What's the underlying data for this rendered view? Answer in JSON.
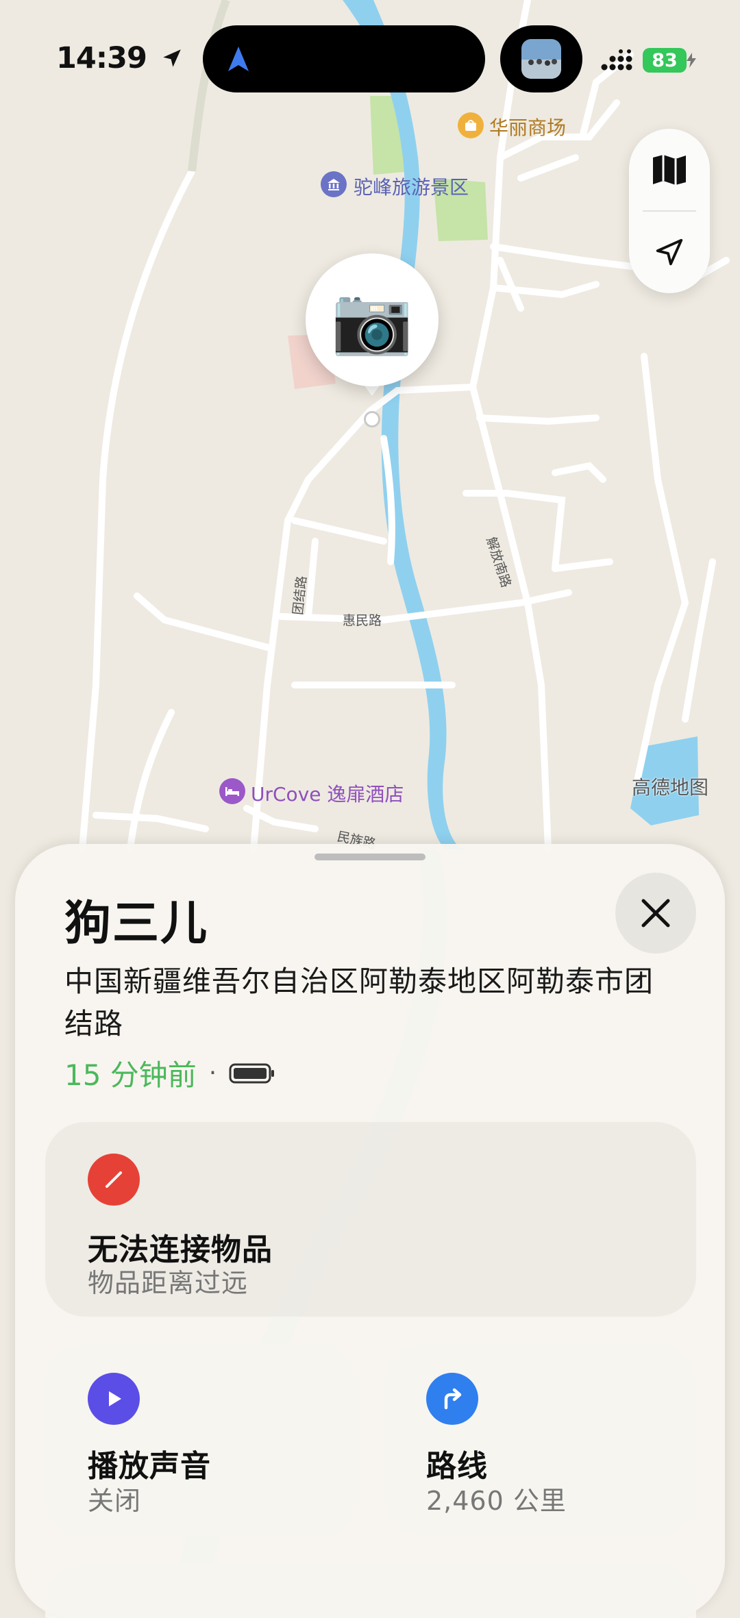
{
  "status_bar": {
    "time": "14:39",
    "battery": "83",
    "icons": [
      "location-arrow-icon",
      "navigation-icon",
      "signal-icon",
      "charging-bolt-icon"
    ]
  },
  "map": {
    "labels": {
      "mall": "华丽商场",
      "scenic": "驼峰旅游景区",
      "road_jiefang": "解放南路",
      "road_huimin": "惠民路",
      "road_tuanjie": "团结路",
      "road_minzu": "民族路",
      "hotel": "UrCove 逸扉酒店",
      "attribution": "高德地图"
    },
    "colors": {
      "land": "#eeeae1",
      "river": "#8fd0ef",
      "park": "#c6e3a8",
      "road": "#ffffff"
    }
  },
  "map_controls": {
    "icons": [
      "map-icon",
      "location-arrow-icon"
    ]
  },
  "pin": {
    "emoji": "📷"
  },
  "sheet": {
    "title": "狗三儿",
    "address": "中国新疆维吾尔自治区阿勒泰地区阿勒泰市团结路",
    "last_seen": "15 分钟前",
    "separator": "·",
    "cards": {
      "connection": {
        "title": "无法连接物品",
        "subtitle": "物品距离过远",
        "color": "#e64136",
        "icon": "slash-icon"
      },
      "sound": {
        "title": "播放声音",
        "subtitle": "关闭",
        "color": "#5b4ee6",
        "icon": "play-icon"
      },
      "directions": {
        "title": "路线",
        "subtitle": "2,460 公里",
        "color": "#2f7fef",
        "icon": "directions-arrow-icon"
      }
    }
  }
}
